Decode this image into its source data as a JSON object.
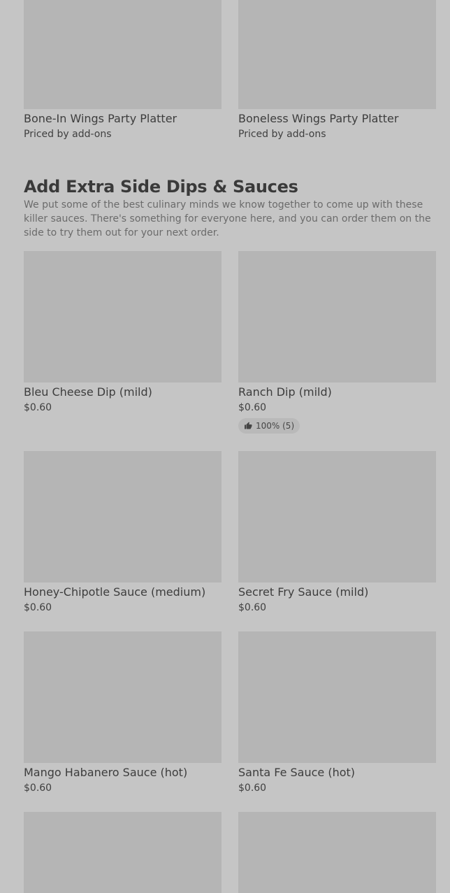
{
  "top_items": [
    {
      "name": "Bone-In Wings Party Platter",
      "price": "Priced by add-ons"
    },
    {
      "name": "Boneless Wings Party Platter",
      "price": "Priced by add-ons"
    }
  ],
  "section": {
    "title": "Add Extra Side Dips & Sauces",
    "description": "We put some of the best culinary minds we know together to come up with these killer sauces. There's something for everyone here, and you can order them on the side to try them out for your next order."
  },
  "items": [
    {
      "name": "Bleu Cheese Dip (mild)",
      "price": "$0.60"
    },
    {
      "name": "Ranch Dip (mild)",
      "price": "$0.60",
      "rating": "100% (5)"
    },
    {
      "name": "Honey-Chipotle Sauce (medium)",
      "price": "$0.60"
    },
    {
      "name": "Secret Fry Sauce (mild)",
      "price": "$0.60"
    },
    {
      "name": "Mango Habanero Sauce (hot)",
      "price": "$0.60"
    },
    {
      "name": "Santa Fe Sauce (hot)",
      "price": "$0.60"
    }
  ]
}
